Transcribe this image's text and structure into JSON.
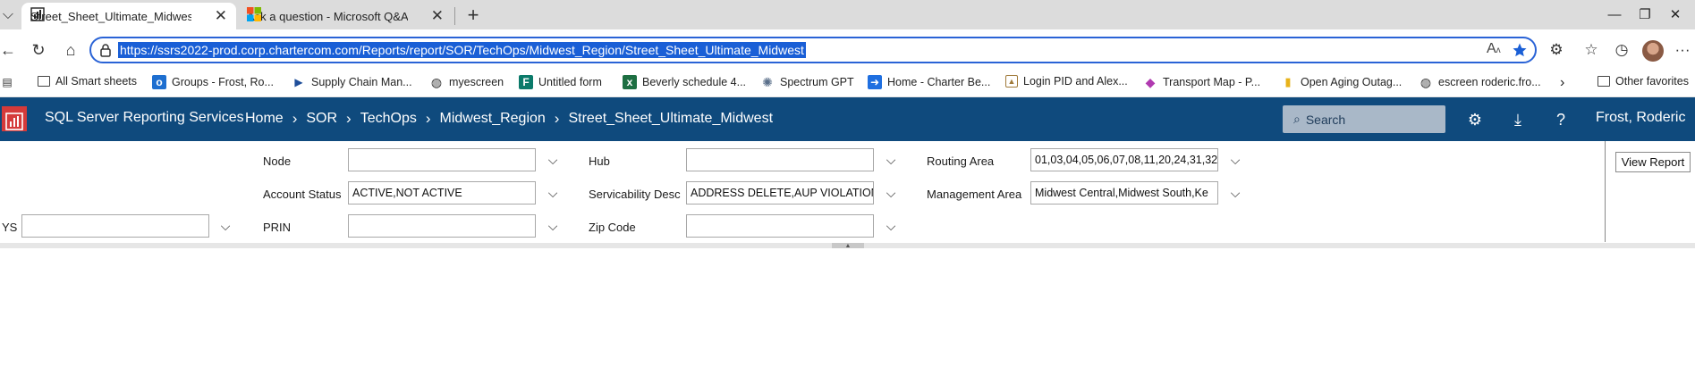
{
  "browser": {
    "tabs": [
      {
        "title": "Street_Sheet_Ultimate_Midwest - S",
        "active": true,
        "icon": "chart-icon"
      },
      {
        "title": "Ask a question - Microsoft Q&A",
        "active": false,
        "icon": "microsoft-icon"
      }
    ],
    "tab_close_glyph": "✕",
    "new_tab_glyph": "+",
    "window_controls": {
      "minimize": "—",
      "restore": "❐",
      "close": "✕"
    },
    "url": "https://ssrs2022-prod.corp.chartercom.com/Reports/report/SOR/TechOps/Midwest_Region/Street_Sheet_Ultimate_Midwest",
    "nav_glyphs": {
      "back": "←",
      "refresh": "↻",
      "home": "⌂",
      "more": "···"
    },
    "favorites": [
      {
        "label": "All Smart sheets",
        "icon": "folder-icon",
        "color": "#ffffff"
      },
      {
        "label": "Groups - Frost, Ro...",
        "icon": "outlook-icon",
        "color": "#1e6fd0"
      },
      {
        "label": "Supply Chain Man...",
        "icon": "play-icon",
        "color": "#1f4e9a"
      },
      {
        "label": "myescreen",
        "icon": "globe-icon",
        "color": "#ffffff"
      },
      {
        "label": "Untitled form",
        "icon": "forms-icon",
        "color": "#0b7a6a"
      },
      {
        "label": "Beverly schedule 4...",
        "icon": "excel-icon",
        "color": "#1d6f42"
      },
      {
        "label": "Spectrum GPT",
        "icon": "gpt-icon",
        "color": "#5a6f8a"
      },
      {
        "label": "Home - Charter Be...",
        "icon": "arrow-icon",
        "color": "#1f6fe0"
      },
      {
        "label": "Login PID and Alex...",
        "icon": "image-icon",
        "color": "#a07a3a"
      },
      {
        "label": "Transport Map - P...",
        "icon": "diamond-icon",
        "color": "#b03ab0"
      },
      {
        "label": "Open Aging Outag...",
        "icon": "powerbi-icon",
        "color": "#e8b21a"
      },
      {
        "label": "escreen roderic.fro...",
        "icon": "globe-icon",
        "color": "#ffffff"
      }
    ],
    "favorites_overflow": "›",
    "other_favorites": "Other favorites"
  },
  "ssrs": {
    "app_name": "SQL Server Reporting Services",
    "breadcrumbs": [
      "Home",
      "SOR",
      "TechOps",
      "Midwest_Region",
      "Street_Sheet_Ultimate_Midwest"
    ],
    "search_placeholder": "Search",
    "user": "Frost, Roderic",
    "brand_color": "#0f4a7d"
  },
  "params": {
    "ys": {
      "label": "YS",
      "value": ""
    },
    "node": {
      "label": "Node",
      "value": ""
    },
    "account_status": {
      "label": "Account Status",
      "value": "ACTIVE,NOT ACTIVE"
    },
    "prin": {
      "label": "PRIN",
      "value": ""
    },
    "hub": {
      "label": "Hub",
      "value": ""
    },
    "serviceability_desc": {
      "label": "Servicability Desc",
      "value": "ADDRESS DELETE,AUP VIOLATION"
    },
    "zip_code": {
      "label": "Zip Code",
      "value": ""
    },
    "routing_area": {
      "label": "Routing Area",
      "value": "01,03,04,05,06,07,08,11,20,24,31,32"
    },
    "management_area": {
      "label": "Management Area",
      "value": "Midwest Central,Midwest South,Ke"
    },
    "view_report": "View Report",
    "dropdown_glyph": "⌵"
  }
}
